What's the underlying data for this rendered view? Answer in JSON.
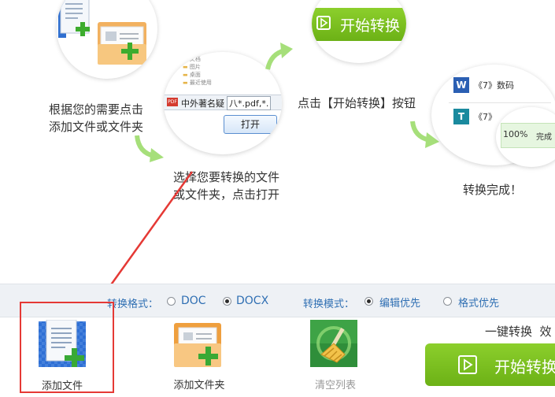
{
  "steps": {
    "step1": {
      "line1": "根据您的需要点击",
      "line2": "添加文件或文件夹"
    },
    "step2": {
      "line1": "选择您要转换的文件",
      "line2": "或文件夹，点击打开",
      "dialog_filename": "中外著名疑",
      "dialog_filter": "八*.pdf,*.",
      "dialog_open_label": "打开",
      "folder_items": [
        "文档",
        "图片",
        "桌面",
        "最近使用"
      ]
    },
    "step3": {
      "text": "点击【开始转换】按钮",
      "button_label": "开始转换"
    },
    "step4": {
      "text": "转换完成！",
      "file1_name": "《7》数码",
      "file2_name": "《7》",
      "progress_text": "100%",
      "status_text": "完成"
    }
  },
  "options": {
    "format_label": "转换格式：",
    "format_options": [
      "DOC",
      "DOCX"
    ],
    "format_selected": "DOCX",
    "mode_label": "转换模式：",
    "mode_options": [
      "编辑优先",
      "格式优先"
    ],
    "mode_selected": "编辑优先"
  },
  "toolbar": {
    "add_file_label": "添加文件",
    "add_folder_label": "添加文件夹",
    "clear_list_label": "清空列表",
    "one_click_text": "一键转换  效",
    "start_button_label": "开始转换"
  },
  "colors": {
    "accent_green": "#7cc020",
    "highlight_red": "#e53935",
    "option_blue": "#2f6fb3"
  }
}
